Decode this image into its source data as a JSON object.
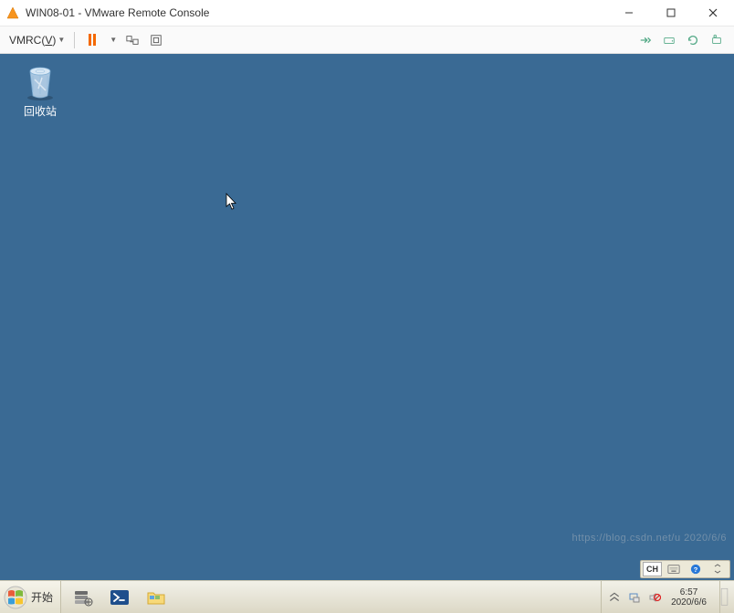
{
  "titlebar": {
    "title": "WIN08-01 - VMware Remote Console"
  },
  "toolbar": {
    "menu_label_pre": "VMRC(",
    "menu_label_key": "V",
    "menu_label_post": ")",
    "icons": {
      "pause": "pause-icon",
      "dropdown": "dropdown-icon",
      "send_keys": "send-keys-icon",
      "fullscreen": "fullscreen-icon",
      "r_send": "auto-send-icon",
      "r_drive": "drive-icon",
      "r_refresh": "refresh-icon",
      "r_settings": "settings-icon"
    }
  },
  "desktop": {
    "recycle_bin_label": "回收站"
  },
  "langbar": {
    "lang_code": "CH"
  },
  "taskbar": {
    "start_label": "开始",
    "clock_time": "6:57",
    "clock_date": "2020/6/6"
  },
  "watermark": "https://blog.csdn.net/u 2020/6/6"
}
